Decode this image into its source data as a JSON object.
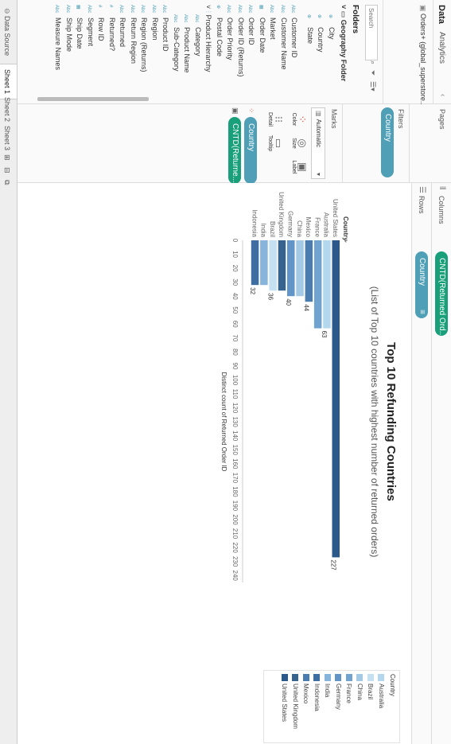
{
  "data_pane": {
    "tab_data": "Data",
    "tab_analytics": "Analytics",
    "datasource": "Orders+ (global_superstore...",
    "search_placeholder": "Search",
    "folders_label": "Folders",
    "geo_folder": "Geography Folder",
    "geo_items": [
      "City",
      "Country",
      "State"
    ],
    "fields": [
      {
        "type": "Abc",
        "label": "Customer ID"
      },
      {
        "type": "Abc",
        "label": "Customer Name"
      },
      {
        "type": "Abc",
        "label": "Market"
      },
      {
        "type": "date",
        "label": "Order Date"
      },
      {
        "type": "Abc",
        "label": "Order ID"
      },
      {
        "type": "Abc",
        "label": "Order ID (Returns)"
      },
      {
        "type": "Abc",
        "label": "Order Priority"
      },
      {
        "type": "geo",
        "label": "Postal Code"
      }
    ],
    "hierarchy": "Product Hierarchy",
    "hierarchy_items": [
      "Category",
      "Product Name",
      "Sub-Category"
    ],
    "fields2": [
      {
        "type": "Abc",
        "label": "Product ID"
      },
      {
        "type": "Abc",
        "label": "Region"
      },
      {
        "type": "Abc",
        "label": "Region (Returns)"
      },
      {
        "type": "Abc",
        "label": "Return Region"
      },
      {
        "type": "Abc",
        "label": "Returned"
      },
      {
        "type": "#",
        "label": "Returned?"
      },
      {
        "type": "#",
        "label": "Row ID"
      },
      {
        "type": "Abc",
        "label": "Segment"
      },
      {
        "type": "date",
        "label": "Ship Date"
      },
      {
        "type": "Abc",
        "label": "Ship Mode"
      },
      {
        "type": "Abc",
        "label": "Measure Names"
      }
    ]
  },
  "cards": {
    "pages": "Pages",
    "filters": "Filters",
    "filter_pill": "Country",
    "marks": "Marks",
    "mark_type": "Automatic",
    "mark_buttons": [
      "Color",
      "Size",
      "Label",
      "Detail",
      "Tooltip"
    ],
    "mark_pills": [
      "Country",
      "CNTD(Returne..."
    ]
  },
  "shelves": {
    "columns": "Columns",
    "rows": "Rows",
    "columns_pill": "CNTD(Returned Ord...",
    "rows_pill": "Country"
  },
  "chart_data": {
    "type": "bar",
    "title": "Top 10 Refunding Countries",
    "subtitle": "(List of Top 10 countries with highest number of returned orders)",
    "ylabel": "Country",
    "xlabel": "Distinct count of Returned Order ID",
    "categories": [
      "United States",
      "Australia",
      "France",
      "Mexico",
      "China",
      "Germany",
      "United Kingdom",
      "Brazil",
      "India",
      "Indonesia"
    ],
    "values": [
      227,
      63,
      63,
      44,
      40,
      40,
      36,
      36,
      32,
      32
    ],
    "colors": [
      "#2b5a8a",
      "#b3d7ec",
      "#70a3d0",
      "#4a7cb0",
      "#a3c9e4",
      "#6195c8",
      "#36648e",
      "#c5e0f1",
      "#86b4da",
      "#3e6ea1"
    ],
    "labeled": [
      "227",
      "63",
      "",
      "44",
      "",
      "40",
      "",
      "36",
      "",
      "32"
    ],
    "xlim": [
      0,
      245
    ],
    "ticks": [
      0,
      10,
      20,
      30,
      40,
      50,
      60,
      70,
      80,
      90,
      100,
      110,
      120,
      130,
      140,
      150,
      160,
      170,
      180,
      190,
      200,
      210,
      220,
      230,
      240
    ],
    "legend_title": "Country",
    "legend": [
      "Australia",
      "Brazil",
      "China",
      "France",
      "Germany",
      "India",
      "Indonesia",
      "Mexico",
      "United Kingdom",
      "United States"
    ],
    "legend_colors": [
      "#b3d7ec",
      "#c5e0f1",
      "#a3c9e4",
      "#70a3d0",
      "#6195c8",
      "#86b4da",
      "#3e6ea1",
      "#4a7cb0",
      "#36648e",
      "#2b5a8a"
    ]
  },
  "bottom_tabs": {
    "datasource": "Data Source",
    "sheets": [
      "Sheet 1",
      "Sheet 2",
      "Sheet 3"
    ]
  }
}
